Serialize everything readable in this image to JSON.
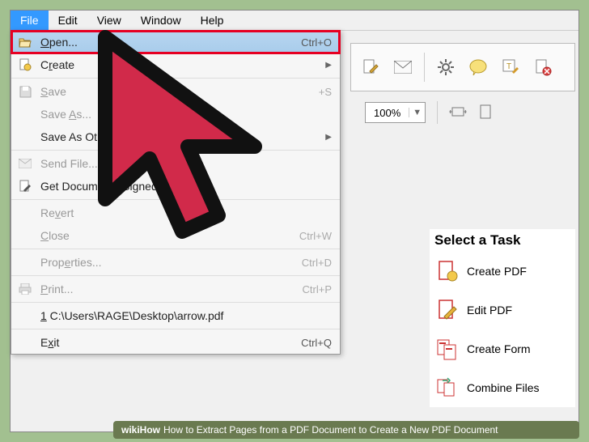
{
  "menubar": {
    "file": "File",
    "edit": "Edit",
    "view": "View",
    "window": "Window",
    "help": "Help"
  },
  "filemenu": {
    "open": {
      "label": "Open...",
      "shortcut": "Ctrl+O"
    },
    "create": {
      "label": "Create"
    },
    "save": {
      "label": "Save",
      "shortcut": "Ctrl+S"
    },
    "saveas": {
      "label": "Save As..."
    },
    "saveother": {
      "label": "Save As Other..."
    },
    "sendfile": {
      "label": "Send File..."
    },
    "getsigned": {
      "label": "Get Documents Signed..."
    },
    "revert": {
      "label": "Revert"
    },
    "close": {
      "label": "Close",
      "shortcut": "Ctrl+W"
    },
    "properties": {
      "label": "Properties...",
      "shortcut": "Ctrl+D"
    },
    "print": {
      "label": "Print...",
      "shortcut": "Ctrl+P"
    },
    "recent": {
      "label": "1 C:\\Users\\RAGE\\Desktop\\arrow.pdf"
    },
    "exit": {
      "label": "Exit",
      "shortcut": "Ctrl+Q"
    }
  },
  "toolbar2": {
    "zoom": "100%"
  },
  "tasks": {
    "header": "Select a Task",
    "createpdf": "Create PDF",
    "editpdf": "Edit PDF",
    "createform": "Create Form",
    "combine": "Combine Files"
  },
  "credit": {
    "prefix": "wikiHow",
    "text": "How to Extract Pages from a PDF Document to Create a New PDF Document"
  }
}
